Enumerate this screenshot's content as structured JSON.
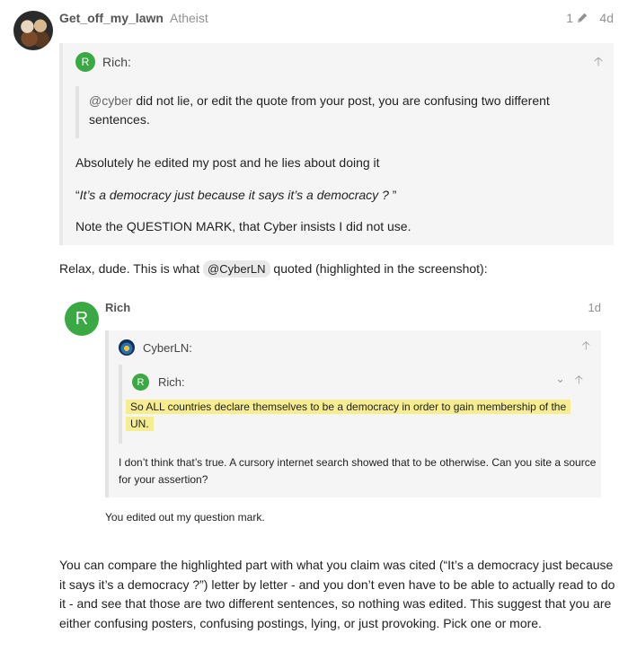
{
  "post": {
    "username": "Get_off_my_lawn",
    "user_title": "Atheist",
    "edit_count": "1",
    "age": "4d"
  },
  "quote": {
    "author_initial": "R",
    "author": "Rich:",
    "inner_mention": "@cyber",
    "inner_text": " did not lie, or edit the quote from your post, you are confusing two different sentences.",
    "line1": "Absolutely he edited my post and he lies about doing it",
    "line2_open": "“",
    "line2_italic": "It’s a democracy just because it says it’s a democracy ?",
    "line2_close": " ”",
    "line3": "Note the QUESTION MARK, that Cyber insists I did not use."
  },
  "relax": {
    "before": "Relax, dude. This is what ",
    "mention": "@CyberLN",
    "after": " quoted (highlighted in the screenshot):"
  },
  "screenshot": {
    "author_initial": "R",
    "author": "Rich",
    "age": "1d",
    "nested_author": "CyberLN:",
    "inner_initial": "R",
    "inner_author": "Rich:",
    "highlight": "So ALL countries declare themselves to be a democracy in order to gain membership of the UN.",
    "cyber_reply": "I don’t think that’s true. A cursory internet search showed that to be otherwise. Can you site a source for your assertion?",
    "rich_reply": "You edited out my question mark."
  },
  "closing": "You can compare the highlighted part with what you claim was cited (“It’s a democracy just because it says it’s a democracy ?”) letter by letter - and you don’t even have to be able to actually read to do it - and see that those are two different sentences, so nothing was edited. This suggest that you are either confusing posters, confusing postings, lying, or just provoking. Pick one or more.",
  "icons": {
    "avatar": "muppets-avatar",
    "pencil": "pencil-icon",
    "arrow": "arrow-up-icon",
    "chevron": "chevron-down-icon"
  },
  "colors": {
    "avatar_green": "#3aa843",
    "highlight": "#f5ed8f",
    "quote_bg": "#f5f5f5"
  }
}
